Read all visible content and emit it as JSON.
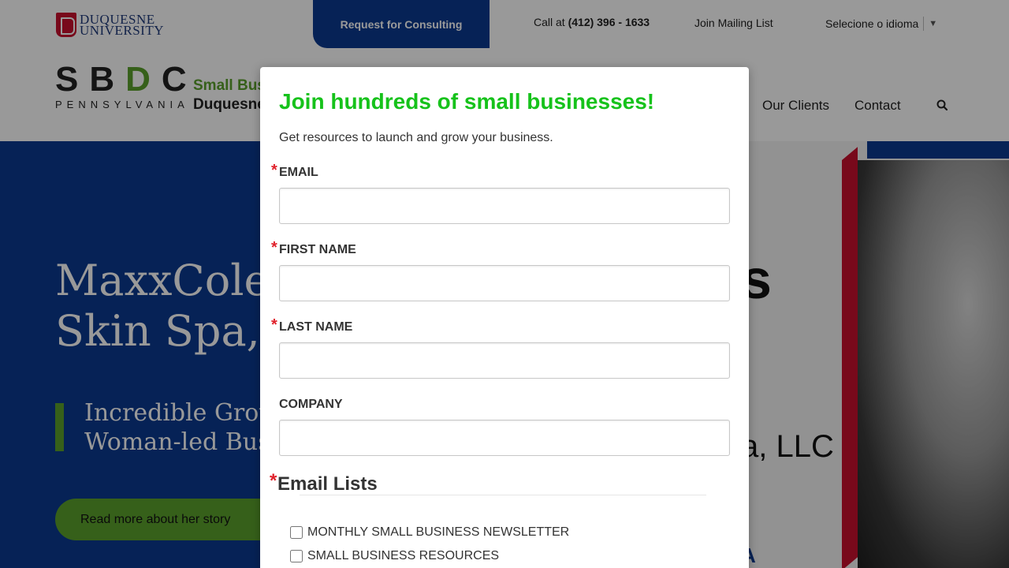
{
  "topbar": {
    "logo_line1": "DUQUESNE",
    "logo_line2": "UNIVERSITY",
    "consult_label": "Request for Consulting",
    "call_prefix": "Call at",
    "call_number": "(412) 396 - 1633",
    "mailing_label": "Join Mailing List",
    "language_label": "Selecione o idioma"
  },
  "header": {
    "logo_letters_1": "SB",
    "logo_letter_d": "D",
    "logo_letter_c": "C",
    "logo_sub": "PENNSYLVANIA",
    "side_line1": "Small Busi",
    "side_line2": "Duquesne",
    "nav": [
      {
        "label": "Our Clients"
      },
      {
        "label": "Contact"
      }
    ]
  },
  "hero": {
    "title_line1": "MaxxCole",
    "title_line2": "Skin Spa, I",
    "sub_line1": "Incredible Grow",
    "sub_line2": "Woman-led Bus",
    "button_label": "Read more about her story",
    "img_text_s": "s",
    "img_text_llc": "a, LLC",
    "img_text_a": "A"
  },
  "modal": {
    "title": "Join hundreds of small businesses!",
    "description": "Get resources to launch and grow your business.",
    "fields": [
      {
        "label": "EMAIL",
        "value": "",
        "required": true
      },
      {
        "label": "FIRST NAME",
        "value": "",
        "required": true
      },
      {
        "label": "LAST NAME",
        "value": "",
        "required": true
      },
      {
        "label": "COMPANY",
        "value": "",
        "required": false
      }
    ],
    "lists_title": "Email Lists",
    "lists": [
      {
        "label": "MONTHLY SMALL BUSINESS NEWSLETTER",
        "checked": false
      },
      {
        "label": "SMALL BUSINESS RESOURCES",
        "checked": false
      }
    ],
    "required_mark": "*"
  },
  "colors": {
    "brand_blue": "#0b3a8f",
    "brand_green": "#5aa02c",
    "title_green": "#16c21b",
    "required_red": "#e0212b"
  }
}
